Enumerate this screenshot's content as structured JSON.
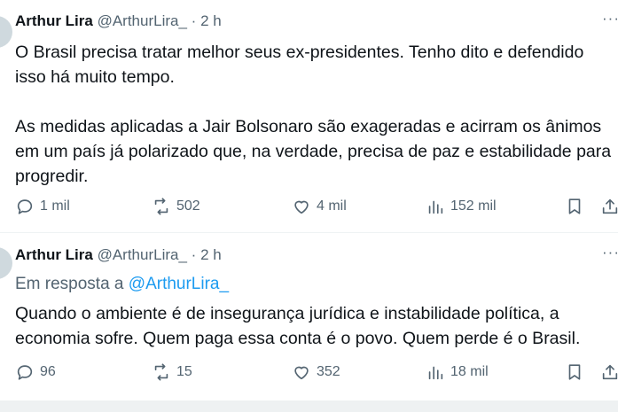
{
  "tweets": [
    {
      "author_name": "Arthur Lira",
      "author_handle": "@ArthurLira_",
      "separator": "·",
      "time": "2 h",
      "more": "···",
      "reply_prefix": "",
      "reply_handle": "",
      "paragraphs": [
        "O Brasil precisa tratar melhor seus ex-presidentes. Tenho dito e defendido isso há muito tempo.",
        "As medidas aplicadas a Jair Bolsonaro são exageradas e acirram os ânimos em um país já polarizado que, na verdade, precisa de paz e estabilidade para progredir."
      ],
      "replies": "1 mil",
      "retweets": "502",
      "likes": "4 mil",
      "views": "152 mil",
      "icons": {
        "reply": "reply-icon",
        "retweet": "retweet-icon",
        "like": "heart-icon",
        "views": "views-icon",
        "bookmark": "bookmark-icon",
        "share": "share-icon"
      }
    },
    {
      "author_name": "Arthur Lira",
      "author_handle": "@ArthurLira_",
      "separator": "·",
      "time": "2 h",
      "more": "···",
      "reply_prefix": "Em resposta a",
      "reply_handle": "@ArthurLira_",
      "paragraphs": [
        "Quando o ambiente é de insegurança jurídica e instabilidade política, a economia sofre. Quem paga essa conta é o povo. Quem perde é o Brasil."
      ],
      "replies": "96",
      "retweets": "15",
      "likes": "352",
      "views": "18 mil",
      "icons": {
        "reply": "reply-icon",
        "retweet": "retweet-icon",
        "like": "heart-icon",
        "views": "views-icon",
        "bookmark": "bookmark-icon",
        "share": "share-icon"
      }
    }
  ],
  "colors": {
    "text": "#0f1419",
    "secondary": "#536471",
    "link": "#1d9bf0",
    "divider": "#eff3f4"
  }
}
